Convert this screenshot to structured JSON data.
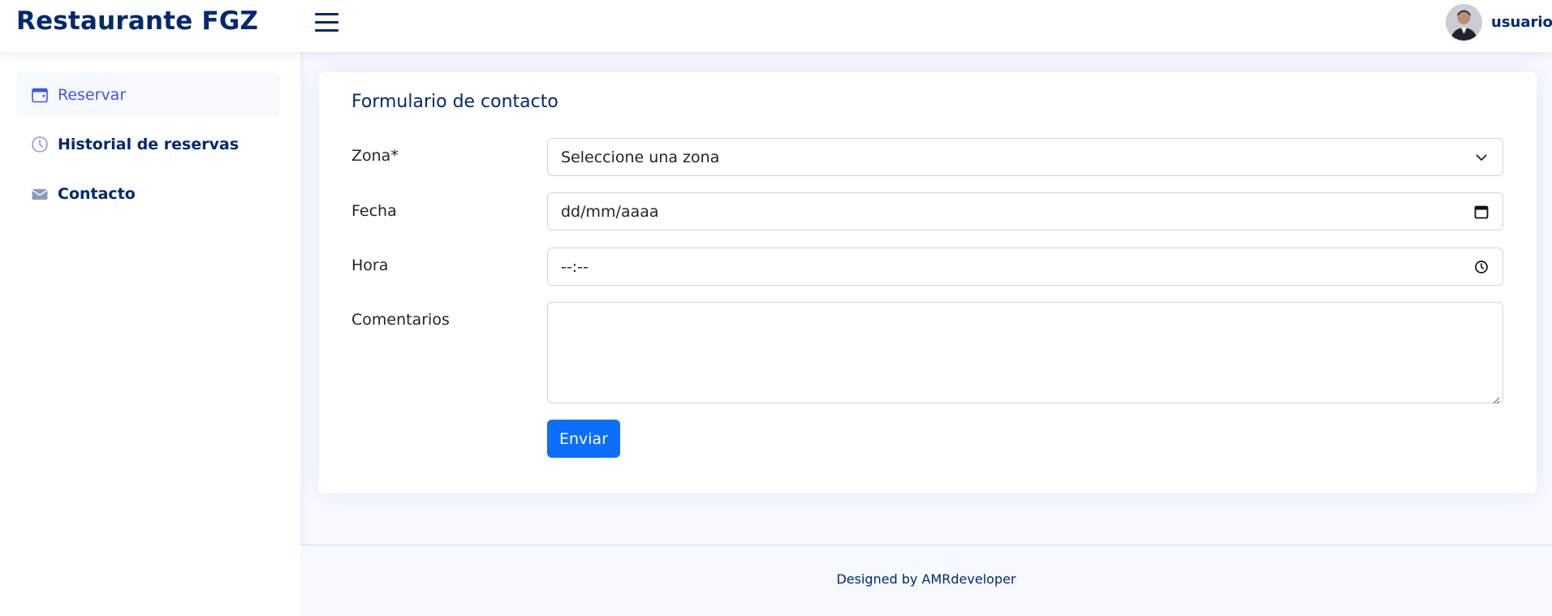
{
  "header": {
    "brand": "Restaurante FGZ",
    "user_name": "usuario"
  },
  "sidebar": {
    "items": [
      {
        "label": "Reservar",
        "icon": "calendar-icon",
        "active": true
      },
      {
        "label": "Historial de reservas",
        "icon": "clock-icon",
        "active": false
      },
      {
        "label": "Contacto",
        "icon": "envelope-icon",
        "active": false
      }
    ]
  },
  "form": {
    "title": "Formulario de contacto",
    "zona": {
      "label": "Zona*",
      "value": "Seleccione una zona"
    },
    "fecha": {
      "label": "Fecha",
      "value": "dd/mm/aaaa"
    },
    "hora": {
      "label": "Hora",
      "value": "--:--"
    },
    "comentarios": {
      "label": "Comentarios",
      "value": ""
    },
    "submit_label": "Enviar"
  },
  "footer": {
    "text": "Designed by AMRdeveloper"
  },
  "colors": {
    "primary_dark": "#012970",
    "accent": "#4154f1",
    "button": "#0d6efd",
    "background": "#f6f9ff"
  }
}
